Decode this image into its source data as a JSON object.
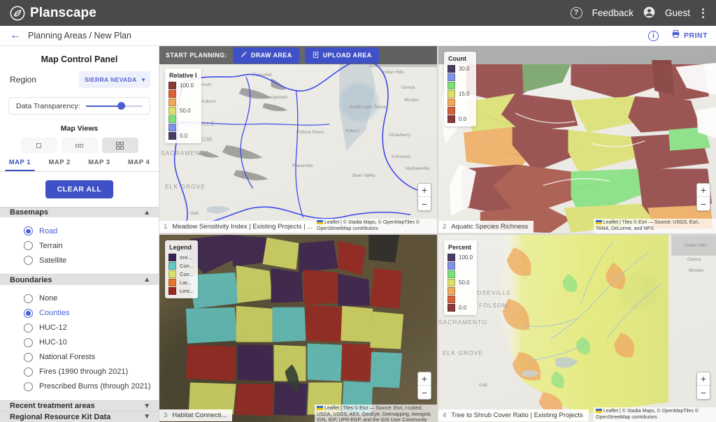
{
  "app": {
    "brand": "Planscape",
    "logo_icon": "planscape-leaf-logo"
  },
  "topbar": {
    "help_icon": "question-mark-circle-icon",
    "feedback": "Feedback",
    "account_icon": "account-circle-icon",
    "user": "Guest",
    "overflow_icon": "kebab-menu-icon"
  },
  "breadcrumb": {
    "back_icon": "arrow-left-icon",
    "text": "Planning Areas / New Plan",
    "info_icon": "info-circle-icon",
    "print_icon": "printer-icon",
    "print_label": "PRINT"
  },
  "panel": {
    "title": "Map Control Panel",
    "region_label": "Region",
    "region_value": "SIERRA NEVADA",
    "region_caret_icon": "chevron-down-icon",
    "transparency_label": "Data Transparency:",
    "transparency_value": 56,
    "map_views_title": "Map Views",
    "view_buttons": [
      {
        "name": "single-map-view",
        "icon": "one-pane-icon",
        "active": false
      },
      {
        "name": "two-map-view",
        "icon": "two-pane-icon",
        "active": false
      },
      {
        "name": "four-map-view",
        "icon": "four-pane-icon",
        "active": true
      }
    ],
    "map_tabs": [
      {
        "label": "MAP 1",
        "active": true
      },
      {
        "label": "MAP 2",
        "active": false
      },
      {
        "label": "MAP 3",
        "active": false
      },
      {
        "label": "MAP 4",
        "active": false
      }
    ],
    "clear_all": "CLEAR ALL",
    "sections": [
      {
        "title": "Basemaps",
        "expanded": true,
        "chevron_icon": "chevron-up-icon",
        "options": [
          {
            "label": "Road",
            "selected": true
          },
          {
            "label": "Terrain",
            "selected": false
          },
          {
            "label": "Satellite",
            "selected": false
          }
        ]
      },
      {
        "title": "Boundaries",
        "expanded": true,
        "chevron_icon": "chevron-up-icon",
        "options": [
          {
            "label": "None",
            "selected": false
          },
          {
            "label": "Counties",
            "selected": true
          },
          {
            "label": "HUC-12",
            "selected": false
          },
          {
            "label": "HUC-10",
            "selected": false
          },
          {
            "label": "National Forests",
            "selected": false
          },
          {
            "label": "Fires (1990 through 2021)",
            "selected": false
          },
          {
            "label": "Prescribed Burns (through 2021)",
            "selected": false
          }
        ]
      },
      {
        "title": "Recent treatment areas",
        "expanded": false,
        "chevron_icon": "chevron-down-icon",
        "options": []
      },
      {
        "title": "Regional Resource Kit Data",
        "expanded": false,
        "chevron_icon": "chevron-down-icon",
        "options": []
      }
    ]
  },
  "start_planning": {
    "label": "START PLANNING:",
    "draw_icon": "pencil-draw-icon",
    "draw_label": "DRAW AREA",
    "upload_icon": "upload-file-icon",
    "upload_label": "UPLOAD AREA"
  },
  "zoom_controls": {
    "zoom_in": "+",
    "zoom_out": "−"
  },
  "attributions": {
    "stadia": "Leaflet | © Stadia Maps, © OpenMapTiles © OpenStreetMap contributors",
    "esri_topo": "Leaflet | Tiles © Esri — Source: USGS, Esri, TANA, DeLorme, and NPS",
    "esri_imagery": "Leaflet | Tiles © Esri — Source: Esri, i-cubed, USDA, USGS, AEX, GeoEye, Getmapping, Aerogrid, IGN, IGP, UPR-EGP, and the GIS User Community"
  },
  "maps": [
    {
      "number": "1",
      "name": "Meadow Sensitivity Index | Existing Projects | ...",
      "selected": true,
      "basemap": "road",
      "attribution_key": "stadia",
      "legend": {
        "title": "Relative I",
        "type": "gradient",
        "swatches": [
          "#8b3a38",
          "#e0603a",
          "#efa95a",
          "#dbe06a",
          "#7ee07a",
          "#7f93e8",
          "#4a3f63"
        ],
        "labels": [
          {
            "index": 0,
            "value": "100.0"
          },
          {
            "index": 3,
            "value": "50.0"
          },
          {
            "index": 6,
            "value": "0.0"
          }
        ]
      },
      "place_labels": [
        "Indian Hills",
        "Genoa",
        "Minden",
        "South Lake Tahoe",
        "Strawberry",
        "Kirkwood",
        "Markleeville",
        "Kyburz",
        "Placerville",
        "Pollock Pines",
        "Georgetown",
        "Auburn",
        "Foresthill",
        "Lincoln",
        "ROSEVILLE",
        "FOLSOM",
        "SACRAMENTO",
        "ELK GROVE",
        "Galt",
        "Bear Valley"
      ]
    },
    {
      "number": "2",
      "name": "Aquatic Species Richness",
      "selected": false,
      "basemap": "topo",
      "attribution_key": "esri_topo",
      "legend": {
        "title": "Count",
        "type": "gradient",
        "swatches": [
          "#4a3f63",
          "#7f93e8",
          "#7ee07a",
          "#dbe06a",
          "#efa95a",
          "#d4603c",
          "#8b3a38"
        ],
        "labels": [
          {
            "index": 0,
            "value": "30.0"
          },
          {
            "index": 3,
            "value": "15.0"
          },
          {
            "index": 6,
            "value": "0.0"
          }
        ]
      },
      "place_labels": []
    },
    {
      "number": "3",
      "name": "Habitat Connecti...",
      "selected": false,
      "basemap": "satellite",
      "attribution_key": "esri_imagery",
      "legend": {
        "title": "Legend",
        "type": "categorical",
        "items": [
          {
            "color": "#3c2352",
            "label": "Irre..."
          },
          {
            "color": "#63c7c4",
            "label": "Con..."
          },
          {
            "color": "#dbe06a",
            "label": "Con..."
          },
          {
            "color": "#e8762c",
            "label": "Lar..."
          },
          {
            "color": "#9b2822",
            "label": "Limi..."
          }
        ]
      },
      "place_labels": []
    },
    {
      "number": "4",
      "name": "Tree to Shrub Cover Ratio | Existing Projects",
      "selected": false,
      "basemap": "road",
      "attribution_key": "stadia",
      "legend": {
        "title": "Percent",
        "type": "gradient",
        "swatches": [
          "#4a3f63",
          "#7f93e8",
          "#7ee07a",
          "#dbe06a",
          "#efa95a",
          "#d4603c",
          "#8b3a38"
        ],
        "labels": [
          {
            "index": 0,
            "value": "100.0"
          },
          {
            "index": 3,
            "value": "50.0"
          },
          {
            "index": 6,
            "value": "0.0"
          }
        ]
      },
      "place_labels": [
        "Indian Hills",
        "Genoa",
        "Minden",
        "ROSEVILLE",
        "FOLSOM",
        "SACRAMENTO",
        "ELK GROVE",
        "Galt"
      ]
    }
  ],
  "colors": {
    "accent": "#3f51c6",
    "topbar_bg": "#4a4a4a",
    "selected_map_outline": "#4b6ef5"
  }
}
